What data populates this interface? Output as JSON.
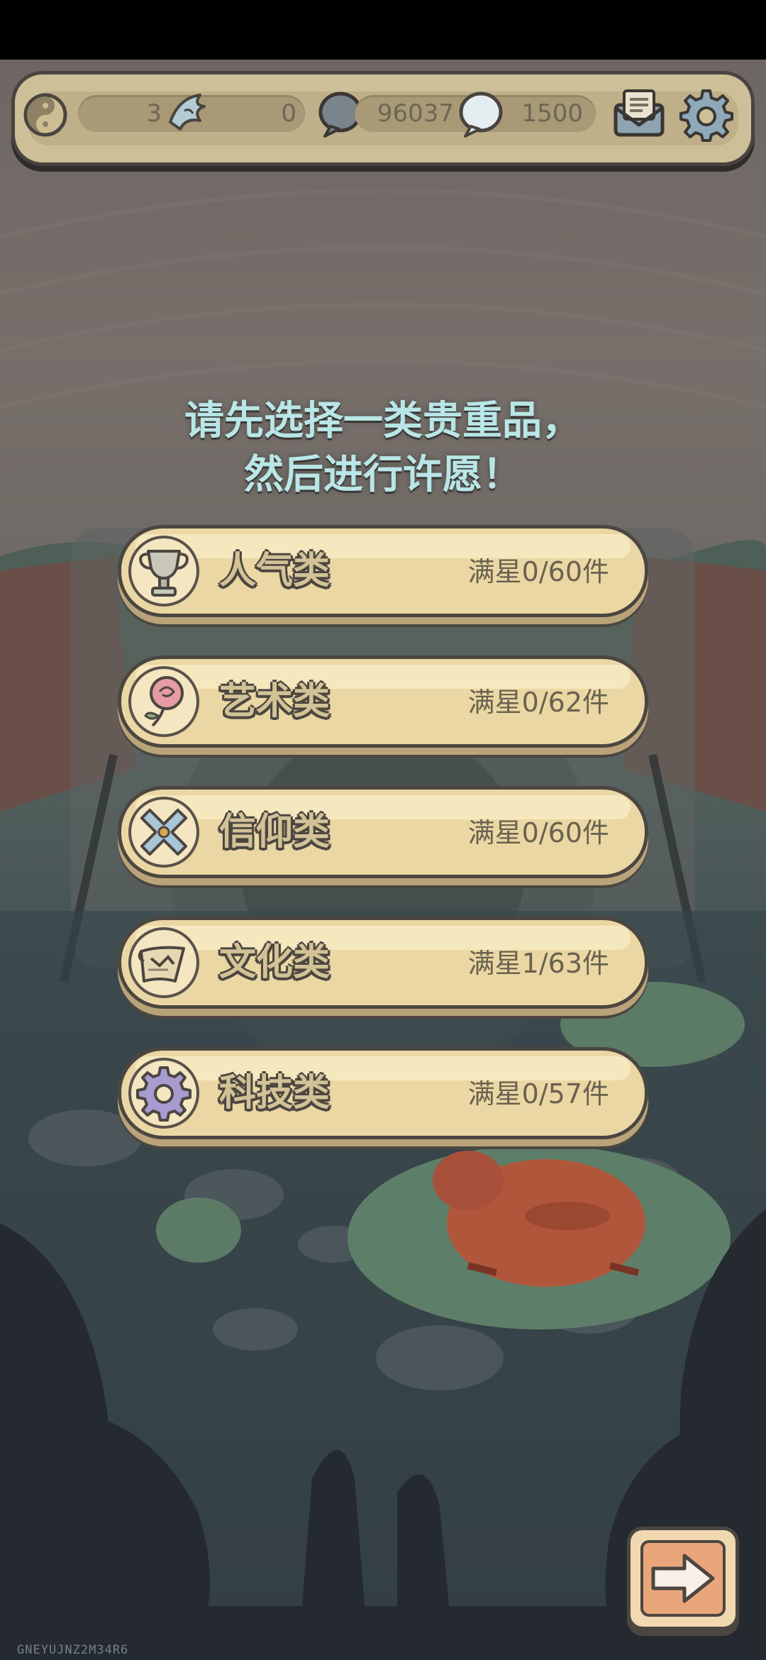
{
  "resources": {
    "slot1_value": "3",
    "slot2_value": "0",
    "slot3_value": "96037",
    "slot4_value": "1500",
    "icons": [
      "yin-yang-icon",
      "swirl-wing-icon",
      "speech-bubble-icon",
      "speech-bubble-light-icon",
      "mail-icon",
      "gear-icon"
    ]
  },
  "prompt": {
    "line1": "请先选择一类贵重品，",
    "line2": "然后进行许愿！"
  },
  "categories": [
    {
      "label": "人气类",
      "count": "满星0/60件",
      "icon": "trophy-icon"
    },
    {
      "label": "艺术类",
      "count": "满星0/62件",
      "icon": "rose-icon"
    },
    {
      "label": "信仰类",
      "count": "满星0/60件",
      "icon": "cross-icon"
    },
    {
      "label": "文化类",
      "count": "满星1/63件",
      "icon": "scroll-icon"
    },
    {
      "label": "科技类",
      "count": "满星0/57件",
      "icon": "cog-icon"
    }
  ],
  "watermark": "GNEYUJNZ2M34R6",
  "colors": {
    "button_fill": "#ead7a3",
    "prompt_text": "#b9e6e7",
    "outline": "#4c4641",
    "next_button": "#e9a67b"
  }
}
